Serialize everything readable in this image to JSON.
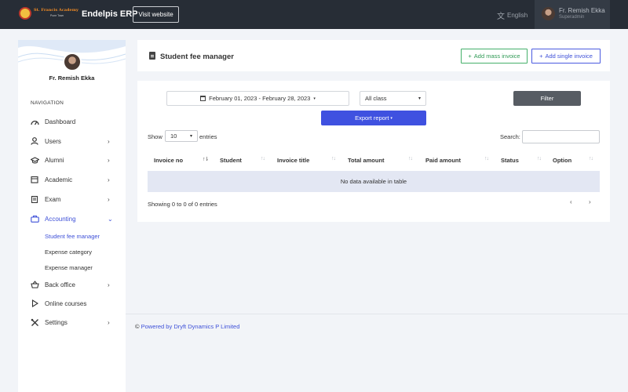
{
  "topbar": {
    "logo_text": "St. Francis Academy",
    "logo_sub": "Pune Town",
    "app_title": "Endelpis ERP",
    "visit_button": "Visit website",
    "language": "English",
    "user_name": "Fr. Remish Ekka",
    "user_role": "Superadmin"
  },
  "sidebar": {
    "profile_name": "Fr. Remish Ekka",
    "nav_heading": "NAVIGATION",
    "items": [
      {
        "label": "Dashboard",
        "icon": "speedometer-icon"
      },
      {
        "label": "Users",
        "icon": "user-icon"
      },
      {
        "label": "Alumni",
        "icon": "graduation-cap-icon"
      },
      {
        "label": "Academic",
        "icon": "calendar-icon"
      },
      {
        "label": "Exam",
        "icon": "clipboard-icon"
      },
      {
        "label": "Accounting",
        "icon": "briefcase-icon"
      },
      {
        "label": "Back office",
        "icon": "basket-icon"
      },
      {
        "label": "Online courses",
        "icon": "play-icon"
      },
      {
        "label": "Settings",
        "icon": "tools-icon"
      }
    ],
    "accounting_sub": [
      "Student fee manager",
      "Expense category",
      "Expense manager"
    ]
  },
  "header": {
    "title": "Student fee manager",
    "add_mass_invoice": "Add mass invoice",
    "add_single_invoice": "Add single invoice"
  },
  "filters": {
    "date_range": "February 01, 2023 - February 28, 2023",
    "class_value": "All class",
    "filter_button": "Filter",
    "export_button": "Export report"
  },
  "table": {
    "show_label": "Show",
    "entries_value": "10",
    "entries_label": "entries",
    "search_label": "Search:",
    "columns": [
      "Invoice no",
      "Student",
      "Invoice title",
      "Total amount",
      "Paid amount",
      "Status",
      "Option"
    ],
    "empty_message": "No data available in table",
    "info": "Showing 0 to 0 of 0 entries"
  },
  "footer": {
    "copyright": "©",
    "text": "Powered by Dryft Dynamics P Limited"
  },
  "colors": {
    "topbar": "#272d36",
    "accent": "#3f51d8",
    "success": "#45b06a",
    "filter_button": "#575c63"
  }
}
